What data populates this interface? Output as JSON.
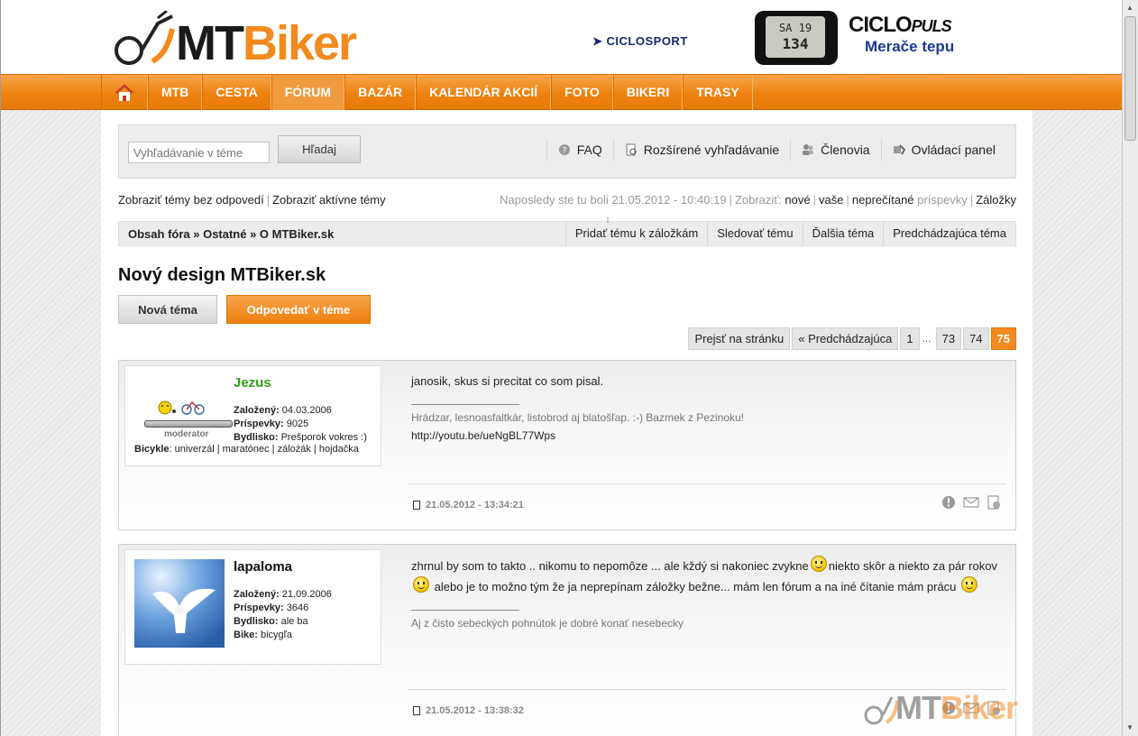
{
  "header": {
    "logo": {
      "mt": "MT",
      "biker": "Biker"
    },
    "ad": {
      "ciclosport": "CICLOSPORT",
      "watch_line1": "SA 19",
      "watch_line2": "134",
      "brand": "CICLO",
      "brand_suffix": "PULS",
      "tagline": "Merače tepu"
    }
  },
  "nav": {
    "items": [
      "MTB",
      "CESTA",
      "FÓRUM",
      "BAZÁR",
      "KALENDÁR AKCIÍ",
      "FOTO",
      "BIKERI",
      "TRASY"
    ],
    "active": "FÓRUM"
  },
  "toolbar": {
    "search_placeholder": "Vyhľadávanie v téme",
    "search_button": "Hľadaj",
    "faq": "FAQ",
    "advanced_search": "Rozšírené vyhľadávanie",
    "members": "Členovia",
    "control_panel": "Ovládací panel"
  },
  "info": {
    "unanswered": "Zobraziť témy bez odpovedí",
    "active": "Zobraziť aktívne témy",
    "last_visit": "Naposledy ste tu boli 21.05.2012 - 10:40:19",
    "show": "Zobraziť:",
    "new": "nové",
    "yours": "vaše",
    "unread": "neprečítané",
    "posts": "príspevky",
    "bookmarks": "Záložky"
  },
  "breadcrumb": {
    "text": "Obsah fóra » Ostatné » O MTBiker.sk",
    "add_bookmark": "Pridať tému k záložkám",
    "watch": "Sledovať tému",
    "next": "Ďalšia téma",
    "prev": "Predchádzajúca téma"
  },
  "topic": {
    "title": "Nový design MTBiker.sk",
    "new_topic": "Nová téma",
    "reply": "Odpovedať v téme"
  },
  "pager": {
    "goto": "Prejsť na stránku",
    "previous": "« Predchádzajúca",
    "first": "1",
    "dots": "...",
    "p73": "73",
    "p74": "74",
    "current": "75"
  },
  "posts": [
    {
      "username": "Jezus",
      "rank": "moderator",
      "joined_label": "Založený:",
      "joined": "04.03.2006",
      "posts_label": "Príspevky:",
      "posts": "9025",
      "location_label": "Bydlisko:",
      "location": "Prešporok vokres :)",
      "bike_label": "Bicykle",
      "bike": ": univerzál | maratónec | zálożák | hojdačka",
      "body": "janosik, skus si precitat co som pisal.",
      "signature": "Hrádzar, lesnoasfaltkár, listobrod aj blatošľap. :-) Bazmek z Pezinoku!",
      "sig_link": "http://youtu.be/ueNgBL77Wps",
      "date": "21.05.2012 - 13:34:21"
    },
    {
      "username": "lapaloma",
      "joined_label": "Založený:",
      "joined": "21.09.2006",
      "posts_label": "Príspevky:",
      "posts": "3646",
      "location_label": "Bydlisko:",
      "location": "ale ba",
      "bike_label": "Bike:",
      "bike": "bicygľa",
      "body_part1": "zhrnul by som to takto .. nikomu to nepomôze ... ale kždý si nakoniec zvykne",
      "body_part2": "niekto skôr a niekto za pár rokov",
      "body_part3": "alebo je to možno tým že ja neprepínam záložky bežne... mám len fórum a na iné čítanie mám prácu",
      "signature": "Aj z čisto sebeckých pohnútok je dobré konať nesebecky",
      "date": "21.05.2012 - 13:38:32"
    }
  ],
  "watermark": {
    "mt": "MT",
    "biker": "Biker"
  },
  "colors": {
    "accent": "#f28a1e",
    "nav": "#ee820f",
    "moderator_name": "#2fa01a"
  }
}
